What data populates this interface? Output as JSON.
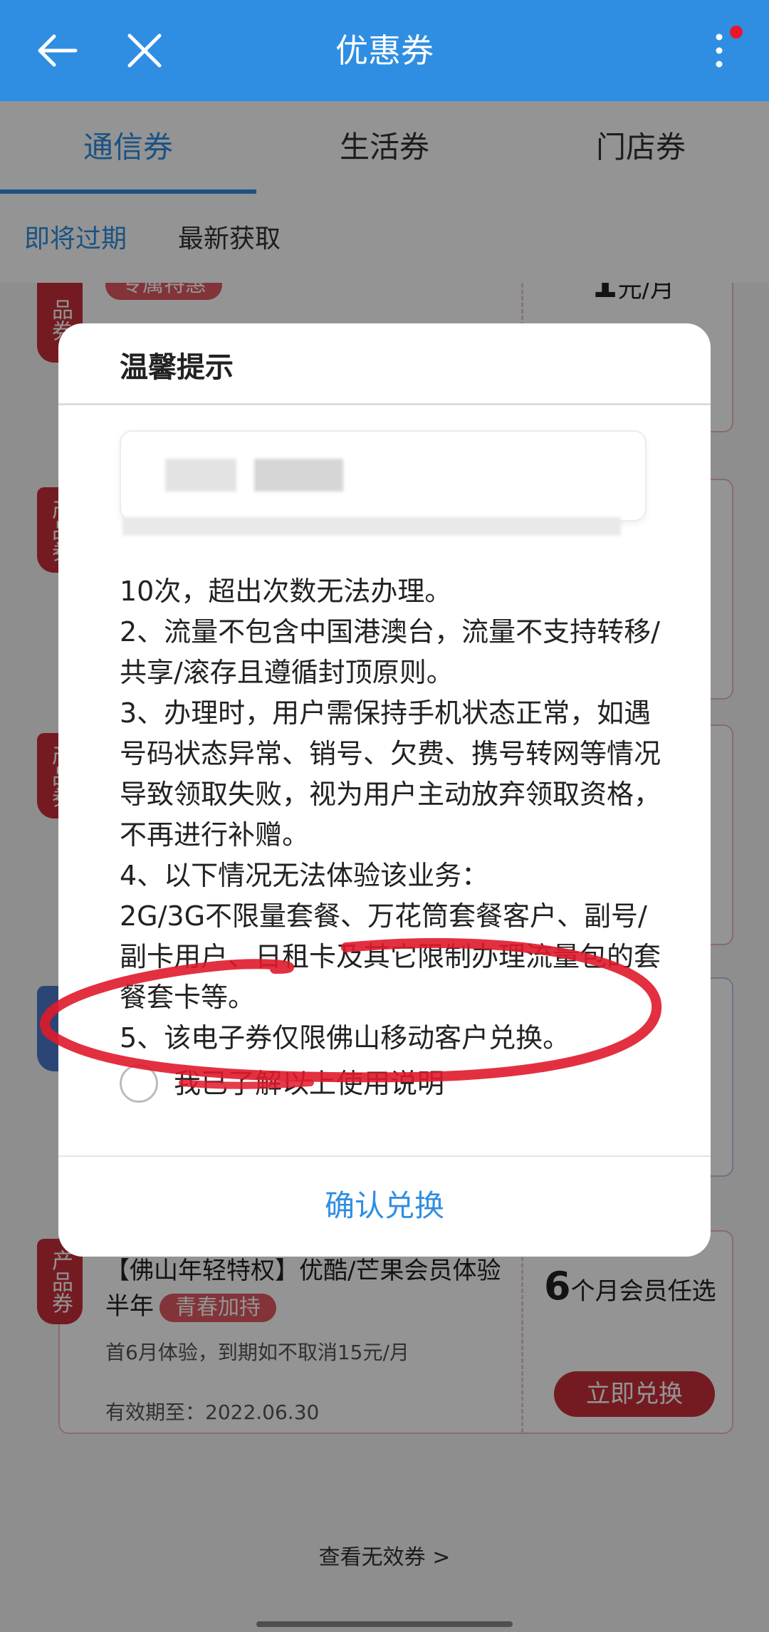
{
  "header": {
    "title": "优惠券",
    "back_icon": "arrow-left-icon",
    "close_icon": "close-icon",
    "more_icon": "more-vertical-icon",
    "accent_color": "#2f8ee2",
    "notification_dot_color": "#e8172d"
  },
  "tabs": [
    {
      "label": "通信券",
      "active": true
    },
    {
      "label": "生活券",
      "active": false
    },
    {
      "label": "门店券",
      "active": false
    }
  ],
  "subtabs": [
    {
      "label": "即将过期",
      "active": true
    },
    {
      "label": "最新获取",
      "active": false
    }
  ],
  "coupons": {
    "first": {
      "tag": "品券",
      "pill": "专属特惠",
      "price_value": "1",
      "price_unit": "元/月"
    },
    "product_tag": "产品券",
    "last": {
      "title": "【佛山年轻特权】优酷/芒果会员体验半年",
      "badge": "青春加持",
      "desc": "首6月体验，到期如不取消15元/月",
      "valid": "有效期至：2022.06.30",
      "right_big": "6",
      "right_text": "个月会员任选",
      "button": "立即兑换"
    }
  },
  "footer": {
    "invalid_link": "查看无效券 >"
  },
  "dialog": {
    "title": "温馨提示",
    "lines": [
      "10次，超出次数无法办理。",
      "2、流量不包含中国港澳台，流量不支持转移/共享/滚存且遵循封顶原则。",
      "3、办理时，用户需保持手机状态正常，如遇号码状态异常、销号、欠费、携号转网等情况导致领取失败，视为用户主动放弃领取资格，不再进行补赠。",
      "4、以下情况无法体验该业务：",
      "2G/3G不限量套餐、万花筒套餐客户、副号/副卡用户、日租卡及其它限制办理流量包的套餐套卡等。",
      "5、该电子券仅限佛山移动客户兑换。"
    ],
    "checkbox_label": "我已了解以上使用说明",
    "confirm_button": "确认兑换"
  },
  "annotation_color": "#e0192b"
}
